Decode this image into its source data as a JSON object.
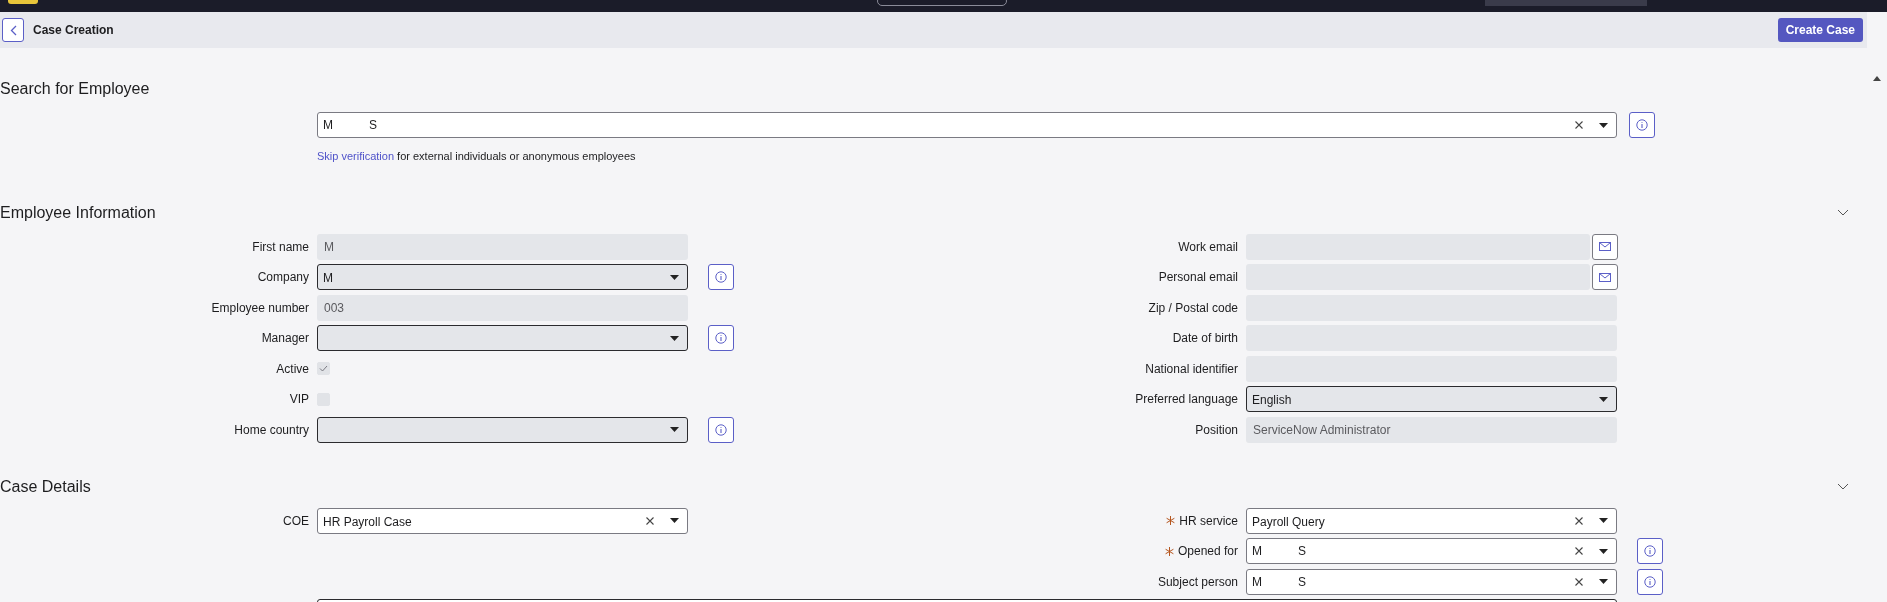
{
  "header": {
    "title": "Case Creation",
    "create_button": "Create Case"
  },
  "search_section": {
    "title": "Search for Employee",
    "field": {
      "value_parts": [
        "M",
        "S"
      ],
      "info_button": true
    },
    "note_link": "Skip verification",
    "note": "for external individuals or anonymous employees"
  },
  "employee_section": {
    "title": "Employee Information",
    "collapsible": true,
    "left_fields": [
      {
        "label": "First name",
        "kind": "readonly",
        "value": "M"
      },
      {
        "label": "Company",
        "kind": "select",
        "value": "M",
        "info_button": true
      },
      {
        "label": "Employee number",
        "kind": "readonly",
        "value": "003"
      },
      {
        "label": "Manager",
        "kind": "select",
        "info_button": true
      },
      {
        "label": "Active",
        "kind": "checkbox",
        "checked": true
      },
      {
        "label": "VIP",
        "kind": "checkbox",
        "checked": false
      },
      {
        "label": "Home country",
        "kind": "select",
        "info_button": true
      }
    ],
    "right_fields": [
      {
        "label": "Work email",
        "kind": "email"
      },
      {
        "label": "Personal email",
        "kind": "email"
      },
      {
        "label": "Zip / Postal code",
        "kind": "readonly"
      },
      {
        "label": "Date of birth",
        "kind": "readonly"
      },
      {
        "label": "National identifier",
        "kind": "readonly"
      },
      {
        "label": "Preferred language",
        "kind": "select",
        "value": "English"
      },
      {
        "label": "Position",
        "kind": "readonly",
        "value": "ServiceNow Administrator"
      }
    ]
  },
  "case_section": {
    "title": "Case Details",
    "collapsible": true,
    "left_fields": [
      {
        "label": "COE",
        "kind": "reference",
        "value": "HR Payroll Case",
        "required": false
      }
    ],
    "right_fields": [
      {
        "label": "HR service",
        "kind": "reference",
        "value": "Payroll Query",
        "required": true
      },
      {
        "label": "Opened for",
        "kind": "reference",
        "value_parts": [
          "M",
          "S"
        ],
        "required": true,
        "info_button": true
      },
      {
        "label": "Subject person",
        "kind": "reference",
        "value_parts": [
          "M",
          "S"
        ],
        "required": false,
        "info_button": true
      }
    ],
    "full_width_field": {
      "kind": "textarea"
    }
  }
}
